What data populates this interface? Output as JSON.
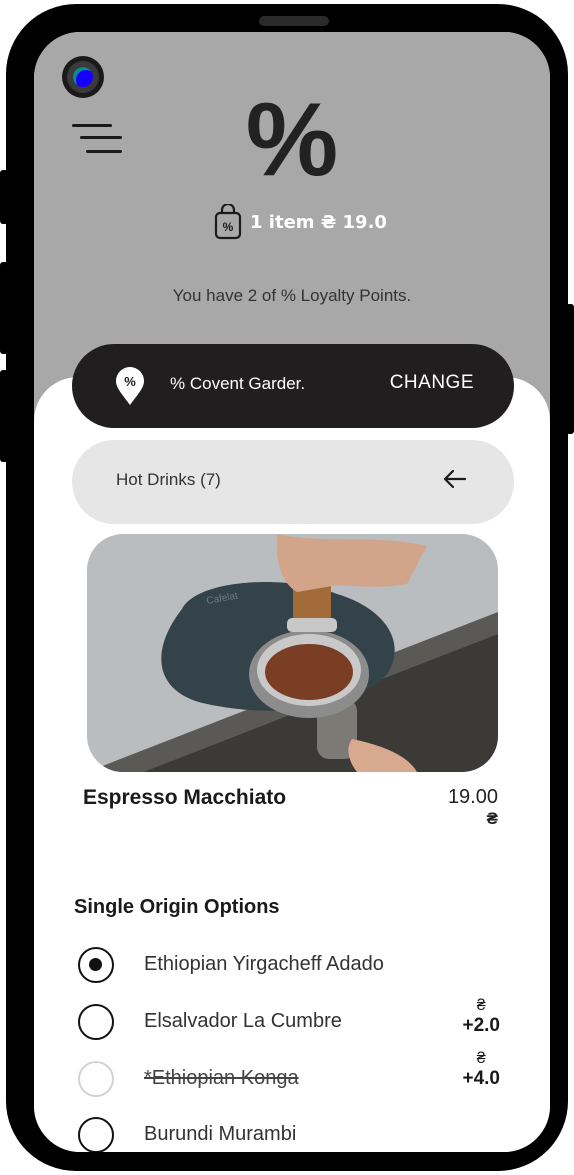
{
  "header": {
    "logo": "%",
    "cart_summary": "1 item ₴ 19.0",
    "cart_icon_label": "%",
    "loyalty_text": "You have 2 of % Loyalty Points."
  },
  "location": {
    "pin_label": "%",
    "name": "% Covent Garder.",
    "change_label": "CHANGE"
  },
  "category": {
    "label": "Hot Drinks (7)"
  },
  "product": {
    "name": "Espresso Macchiato",
    "price": "19.00",
    "currency": "₴",
    "image_text": "Cafelat"
  },
  "options": {
    "title": "Single Origin Options",
    "items": [
      {
        "label": "Ethiopian Yirgacheff Adado",
        "state": "selected",
        "currency": "",
        "extra": ""
      },
      {
        "label": "Elsalvador La Cumbre",
        "state": "unselected",
        "currency": "₴",
        "extra": "+2.0"
      },
      {
        "label": "*Ethiopian Konga",
        "state": "disabled",
        "currency": "₴",
        "extra": "+4.0"
      },
      {
        "label": "Burundi Murambi",
        "state": "unselected",
        "currency": "",
        "extra": ""
      }
    ]
  },
  "icons": {
    "menu": "hamburger-menu-icon",
    "cart": "shopping-bag-icon",
    "pin": "location-pin-icon",
    "back": "arrow-left-icon"
  },
  "colors": {
    "header_bg": "#a8a8a8",
    "dark_pill": "#201e1e",
    "light_pill": "#e6e6e6",
    "accent_text": "#ffffff"
  }
}
